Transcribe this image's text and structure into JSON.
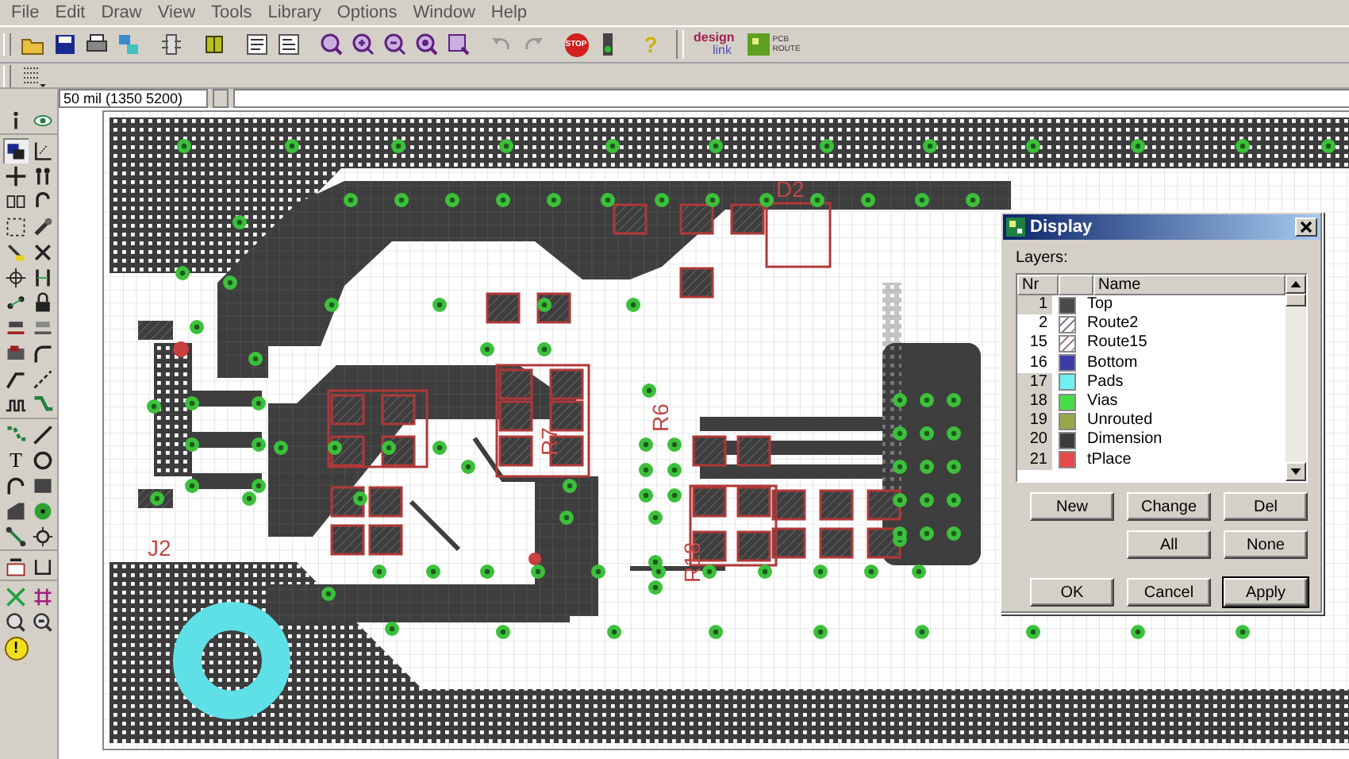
{
  "menu": [
    "File",
    "Edit",
    "Draw",
    "View",
    "Tools",
    "Library",
    "Options",
    "Window",
    "Help"
  ],
  "toolbar": {
    "stop_label": "STOP",
    "help_glyph": "?",
    "logo_design": "design",
    "logo_link": "link",
    "logo_route_top": "PCB",
    "logo_route_bottom": "ROUTE"
  },
  "left_toolbar": {
    "text_tool_glyph": "T",
    "error_glyph": "!"
  },
  "coordinates": "50 mil (1350 5200)",
  "board": {
    "labels": [
      {
        "text": "J2"
      },
      {
        "text": "D2"
      },
      {
        "text": "R7"
      },
      {
        "text": "R6"
      },
      {
        "text": "R18"
      }
    ]
  },
  "dialog": {
    "title": "Display",
    "layers_label": "Layers:",
    "columns": {
      "number": "Nr",
      "name": "Name"
    },
    "layers": [
      {
        "nr": "1",
        "name": "Top",
        "color": "#4a4a4a",
        "kind": "solid",
        "selected": true
      },
      {
        "nr": "2",
        "name": "Route2",
        "color": "#8a7a9a",
        "kind": "hatched",
        "selected": false
      },
      {
        "nr": "15",
        "name": "Route15",
        "color": "#a08080",
        "kind": "hatched",
        "selected": false
      },
      {
        "nr": "16",
        "name": "Bottom",
        "color": "#3c3ca8",
        "kind": "solid",
        "selected": false
      },
      {
        "nr": "17",
        "name": "Pads",
        "color": "#70eef2",
        "kind": "solid",
        "selected": true
      },
      {
        "nr": "18",
        "name": "Vias",
        "color": "#48dd48",
        "kind": "solid",
        "selected": true
      },
      {
        "nr": "19",
        "name": "Unrouted",
        "color": "#98a848",
        "kind": "solid",
        "selected": true
      },
      {
        "nr": "20",
        "name": "Dimension",
        "color": "#3c3c3c",
        "kind": "solid",
        "selected": true
      },
      {
        "nr": "21",
        "name": "tPlace",
        "color": "#e84848",
        "kind": "solid",
        "selected": true
      }
    ],
    "buttons": [
      [
        {
          "label": "New",
          "default": false
        },
        {
          "label": "Change",
          "default": false
        },
        {
          "label": "Del",
          "default": false
        }
      ],
      [
        {
          "label": "All",
          "default": false
        },
        {
          "label": "None",
          "default": false
        }
      ],
      [
        {
          "label": "OK",
          "default": false
        },
        {
          "label": "Cancel",
          "default": false
        },
        {
          "label": "Apply",
          "default": true
        }
      ]
    ]
  }
}
